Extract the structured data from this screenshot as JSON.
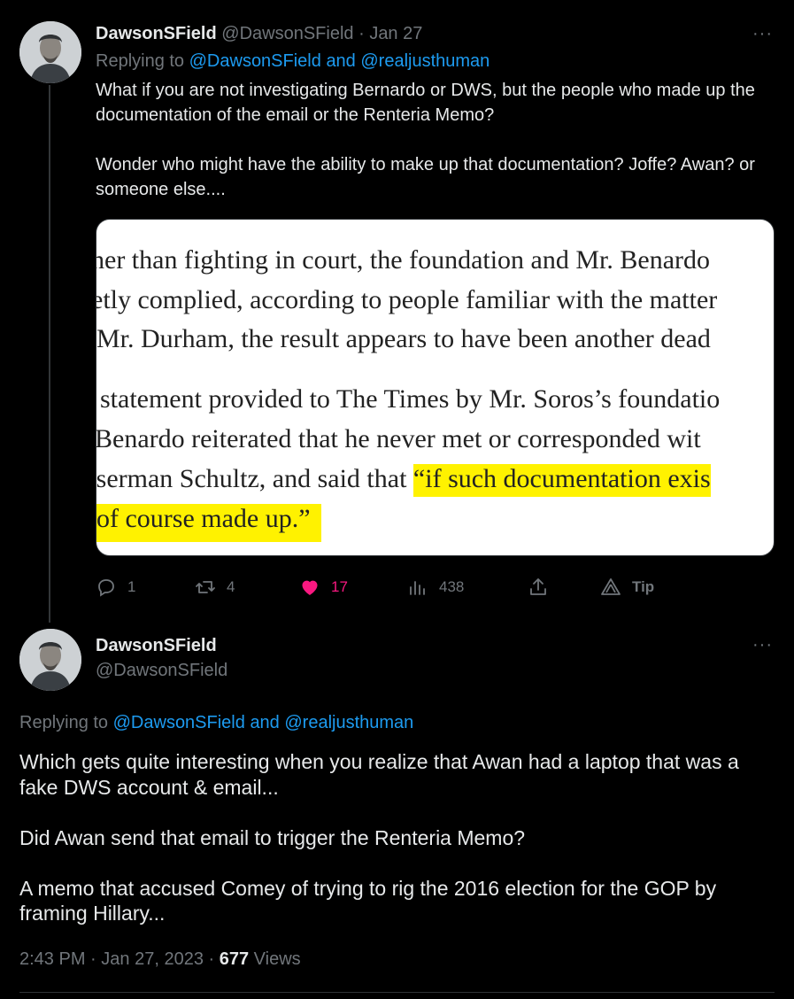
{
  "tweet1": {
    "display_name": "DawsonSField",
    "handle": "@DawsonSField",
    "separator": "·",
    "date": "Jan 27",
    "replying_prefix": "Replying to",
    "reply_user1": "@DawsonSField",
    "reply_and": "and",
    "reply_user2": "@realjusthuman",
    "body_p1": "What if you are not investigating Bernardo or DWS, but the people who made up the documentation of the email or the Renteria Memo?",
    "body_p2": "Wonder who might have the ability to make up that documentation? Joffe? Awan? or someone else....",
    "more": "···",
    "media": {
      "line1": "her than fighting in court, the foundation and Mr. Benardo",
      "line2": "etly complied, according to people familiar with the matter",
      "line3": "Mr. Durham, the result appears to have been another dead",
      "line4": "statement provided to The Times by Mr. Soros’s foundatio",
      "line5": "Benardo reiterated that he never met or corresponded wit",
      "line6_plain": "sserman Schultz, and said that ",
      "line6_hl": "“if such documentation exis",
      "line7_hl": "of course made up.”"
    },
    "actions": {
      "replies": "1",
      "retweets": "4",
      "likes": "17",
      "views": "438",
      "tip": "Tip"
    },
    "colors": {
      "like": "#f91880",
      "link": "#1d9bf0",
      "muted": "#71767b",
      "highlight": "#fff200"
    }
  },
  "tweet2": {
    "display_name": "DawsonSField",
    "handle": "@DawsonSField",
    "more": "···",
    "replying_prefix": "Replying to",
    "reply_user1": "@DawsonSField",
    "reply_and": "and",
    "reply_user2": "@realjusthuman",
    "body_p1": "Which gets quite interesting when you realize that Awan had a laptop that was a fake DWS account & email...",
    "body_p2": "Did Awan send that email to trigger the Renteria Memo?",
    "body_p3": "A memo that accused Comey of trying to rig the 2016 election for the GOP by framing Hillary...",
    "time": "2:43 PM",
    "separator": "·",
    "date": "Jan 27, 2023",
    "views_count": "677",
    "views_label": "Views"
  },
  "icons": {
    "reply": "reply-icon",
    "retweet": "retweet-icon",
    "like": "heart-icon",
    "views": "views-icon",
    "share": "share-icon",
    "tip": "tip-icon",
    "more": "more-icon"
  }
}
